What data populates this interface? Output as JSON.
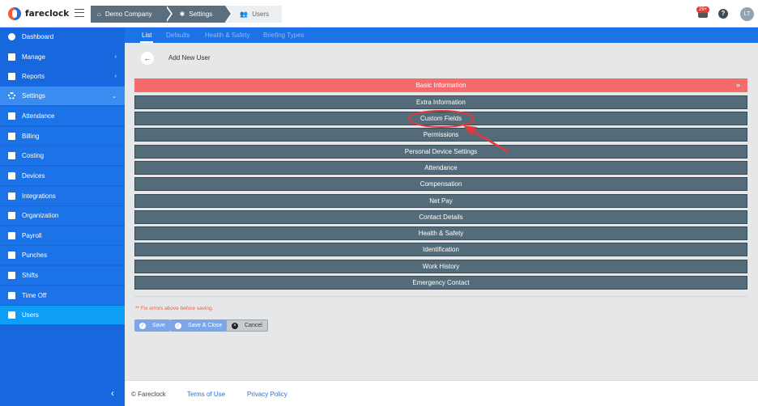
{
  "brand": {
    "name": "fareclock"
  },
  "breadcrumbs": [
    {
      "label": "Demo Company",
      "icon": "home-icon"
    },
    {
      "label": "Settings",
      "icon": "gear-icon"
    },
    {
      "label": "Users",
      "icon": "users-icon"
    }
  ],
  "header": {
    "notification_count": "29+",
    "help": "?",
    "avatar": "LT"
  },
  "sidebar": {
    "items": [
      {
        "label": "Dashboard"
      },
      {
        "label": "Manage",
        "chevron": "‹"
      },
      {
        "label": "Reports",
        "chevron": "‹"
      },
      {
        "label": "Settings",
        "chevron": "⌄"
      },
      {
        "label": "Attendance"
      },
      {
        "label": "Billing"
      },
      {
        "label": "Costing"
      },
      {
        "label": "Devices"
      },
      {
        "label": "Integrations"
      },
      {
        "label": "Organization"
      },
      {
        "label": "Payroll"
      },
      {
        "label": "Punches"
      },
      {
        "label": "Shifts"
      },
      {
        "label": "Time Off"
      },
      {
        "label": "Users"
      }
    ],
    "collapse": "‹"
  },
  "tabs": [
    {
      "label": "List"
    },
    {
      "label": "Defaults"
    },
    {
      "label": "Health & Safety"
    },
    {
      "label": "Briefing Types"
    }
  ],
  "main": {
    "title": "Add New User",
    "sections": [
      {
        "label": "Basic Information"
      },
      {
        "label": "Extra Information"
      },
      {
        "label": "Custom Fields"
      },
      {
        "label": "Permissions"
      },
      {
        "label": "Personal Device Settings"
      },
      {
        "label": "Attendance"
      },
      {
        "label": "Compensation"
      },
      {
        "label": "Net Pay"
      },
      {
        "label": "Contact Details"
      },
      {
        "label": "Health & Safety"
      },
      {
        "label": "Identification"
      },
      {
        "label": "Work History"
      },
      {
        "label": "Emergency Contact"
      }
    ],
    "error": "** Fix errors above before saving.",
    "buttons": {
      "save": "Save",
      "save_close": "Save & Close",
      "cancel": "Cancel"
    }
  },
  "footer": {
    "copyright": "© Fareclock",
    "terms": "Terms of Use",
    "privacy": "Privacy Policy"
  },
  "colors": {
    "sidebar": "#1767df",
    "section": "#546c7a",
    "open_section": "#f56b6b",
    "annotation": "#e03a3a"
  }
}
